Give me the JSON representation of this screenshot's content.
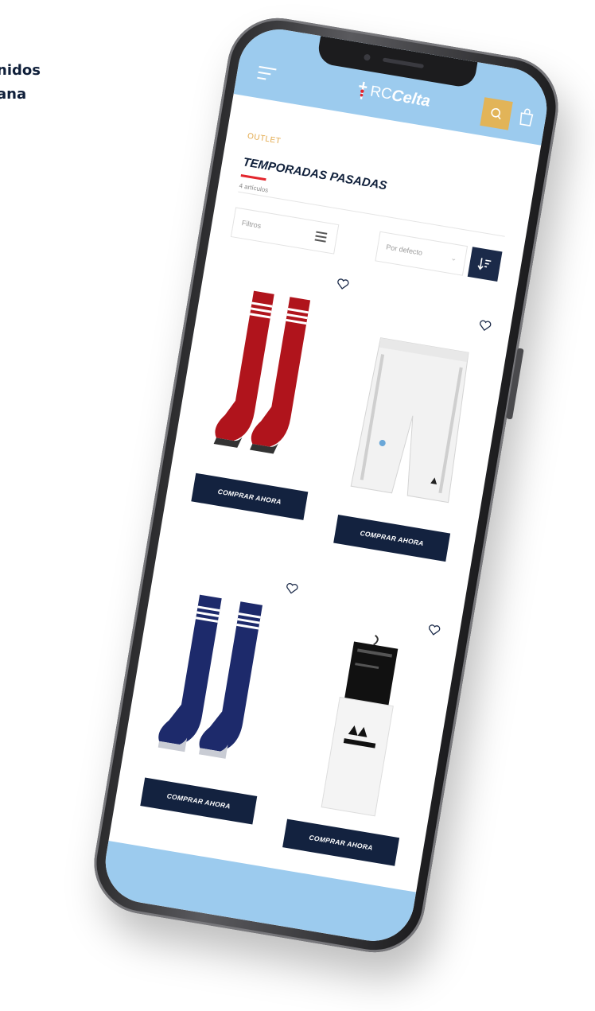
{
  "side_text": "nidos\nana",
  "header": {
    "logo_rc": "RC",
    "logo_celta": "Celta",
    "brand_color": "#9ccbee",
    "search_color": "#e2b458"
  },
  "page": {
    "breadcrumb": "OUTLET",
    "title": "TEMPORADAS PASADAS",
    "item_count": "4 artículos",
    "filter_label": "Filtros",
    "sort_label": "Por defecto"
  },
  "products": [
    {
      "name": "red-socks",
      "button": "COMPRAR AHORA",
      "color": "#b0141c"
    },
    {
      "name": "white-shorts",
      "button": "COMPRAR AHORA",
      "color": "#f2f2f2"
    },
    {
      "name": "navy-socks",
      "button": "COMPRAR AHORA",
      "color": "#1d2a6b"
    },
    {
      "name": "white-socks",
      "button": "COMPRAR AHORA",
      "color": "#f4f4f4"
    }
  ]
}
